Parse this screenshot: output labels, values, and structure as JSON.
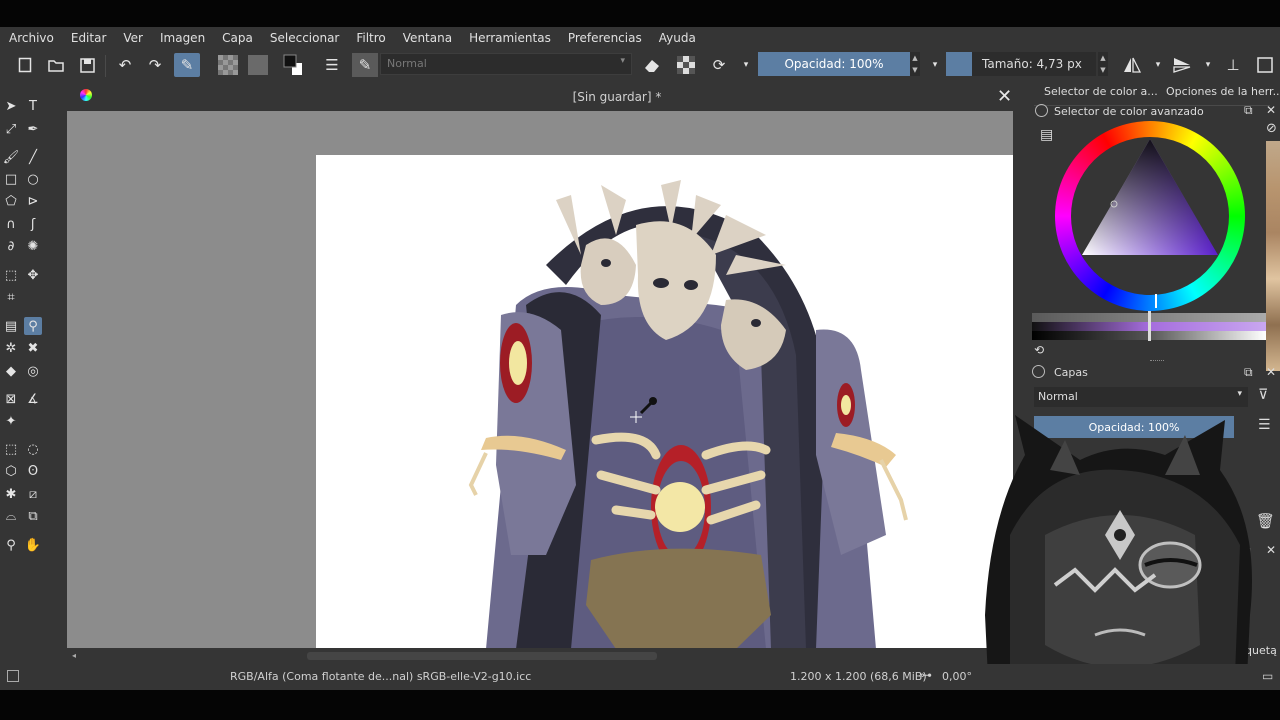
{
  "menu": [
    "Archivo",
    "Editar",
    "Ver",
    "Imagen",
    "Capa",
    "Seleccionar",
    "Filtro",
    "Ventana",
    "Herramientas",
    "Preferencias",
    "Ayuda"
  ],
  "toolbar": {
    "blend_mode": "Normal",
    "opacity_label": "Opacidad: 100%",
    "size_label": "Tamaño: 4,73 px"
  },
  "document": {
    "title": "[Sin guardar] *"
  },
  "right_dock": {
    "tab1": "Selector de color a...",
    "tab2": "Opciones de la herr...",
    "color_docker_title": "Selector de color avanzado",
    "layers_title": "Capas",
    "layers_blend": "Normal",
    "layers_opacity": "Opacidad:  100%",
    "partial_label": "iquetą"
  },
  "status": {
    "color_space": "RGB/Alfa (Coma flotante de...nal)  sRGB-elle-V2-g10.icc",
    "dimensions": "1.200 x 1.200 (68,6 MiB)",
    "rotation": "0,00°"
  },
  "colors": {
    "accent": "#5c7ea3",
    "panel": "#353535",
    "canvas_bg": "#8c8c8c"
  }
}
